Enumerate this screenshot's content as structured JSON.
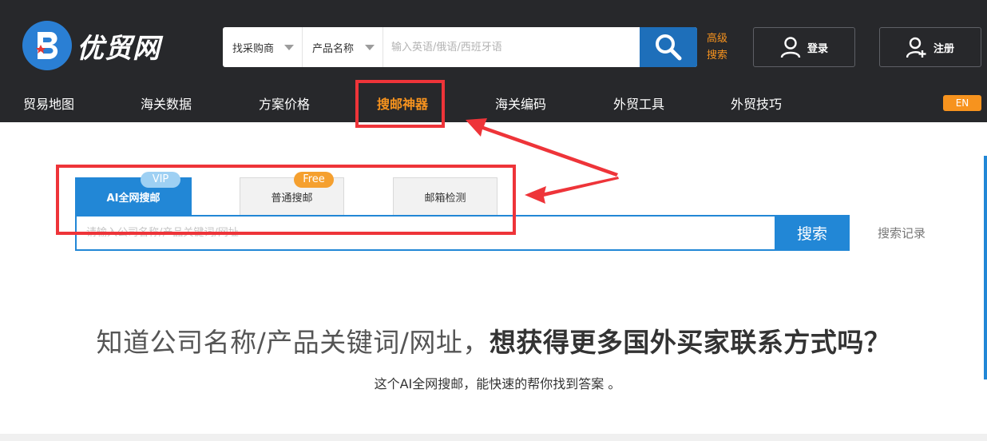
{
  "header": {
    "logo_text": "优贸网",
    "search": {
      "scope_dropdown": "找采购商",
      "field_dropdown": "产品名称",
      "placeholder": "输入英语/俄语/西班牙语"
    },
    "advanced_search": [
      "高级",
      "搜索"
    ],
    "login_label": "登录",
    "register_label": "注册"
  },
  "nav": {
    "items": [
      "贸易地图",
      "海关数据",
      "方案价格",
      "搜邮神器",
      "海关编码",
      "外贸工具",
      "外贸技巧"
    ],
    "active_item": "搜邮神器",
    "lang_badge": "EN"
  },
  "tabs": [
    {
      "label": "AI全网搜邮",
      "tag": "VIP",
      "active": true
    },
    {
      "label": "普通搜邮",
      "tag": "Free",
      "active": false
    },
    {
      "label": "邮箱检测",
      "tag": "",
      "active": false
    }
  ],
  "main_search": {
    "placeholder": "请输入公司名称/产品关键词/网址",
    "button_label": "搜索",
    "history_label": "搜索记录"
  },
  "hero": {
    "headline_part1": "知道公司名称/产品关键词/网址，",
    "headline_part2": "想获得更多国外买家联系方式吗？",
    "subline": "这个AI全网搜邮，能快速的帮你找到答案 。"
  },
  "colors": {
    "header_bg": "#27282b",
    "accent_orange": "#f7931e",
    "primary_blue": "#2287d6",
    "annotation_red": "#ee3439"
  }
}
